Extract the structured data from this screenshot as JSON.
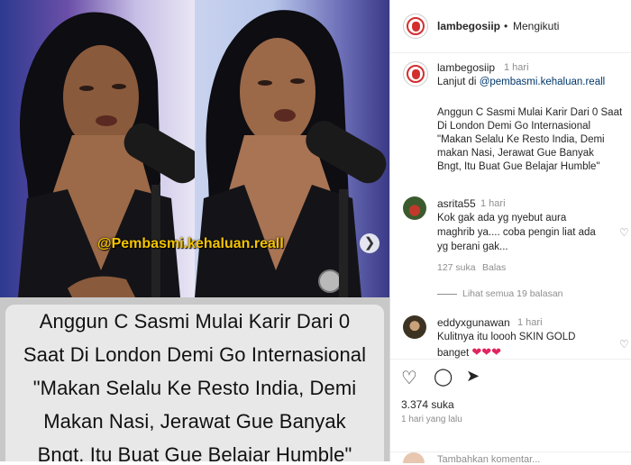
{
  "post": {
    "watermark": "@Pembasmi.kehaluan.reall",
    "caption_lines": [
      "Anggun C Sasmi Mulai Karir Dari 0",
      "Saat Di London Demi Go Internasional",
      "\"Makan Selalu Ke Resto India, Demi",
      "Makan Nasi, Jerawat Gue Banyak",
      "Bngt, Itu Buat Gue Belajar Humble\""
    ]
  },
  "header": {
    "username": "lambegosiip",
    "separator": "•",
    "follow_label": "Mengikuti",
    "more_icon": "more-dots-icon"
  },
  "owner_comment": {
    "username": "lambegosiip",
    "time": "1 hari",
    "line1_prefix": "Lanjut di ",
    "line1_link": "@pembasmi.kehaluan.reall",
    "body": [
      "Anggun C Sasmi Mulai Karir Dari 0 Saat",
      "Di London Demi Go Internasional",
      "\"Makan Selalu Ke Resto India, Demi",
      "makan Nasi, Jerawat Gue Banyak",
      "Bngt, Itu Buat Gue Belajar Humble\""
    ]
  },
  "comments": [
    {
      "username": "asrita55",
      "time": "1 hari",
      "lines": [
        "Kok gak ada yg nyebut aura",
        "maghrib ya.... coba pengin liat ada",
        "yg berani gak..."
      ],
      "likes": "127 suka",
      "reply_label": "Balas",
      "view_replies": "Lihat semua 19 balasan"
    },
    {
      "username": "eddyxgunawan",
      "time": "1 hari",
      "lines": [
        "Kulitnya itu loooh SKIN GOLD",
        "banget"
      ]
    }
  ],
  "actions": {
    "likes": "3.374 suka",
    "date": "1 hari yang lalu",
    "add_comment_placeholder": "Tambahkan komentar..."
  },
  "colors": {
    "accent": "#00376b",
    "heart": "#e0245e",
    "watermark": "#f5c400"
  }
}
